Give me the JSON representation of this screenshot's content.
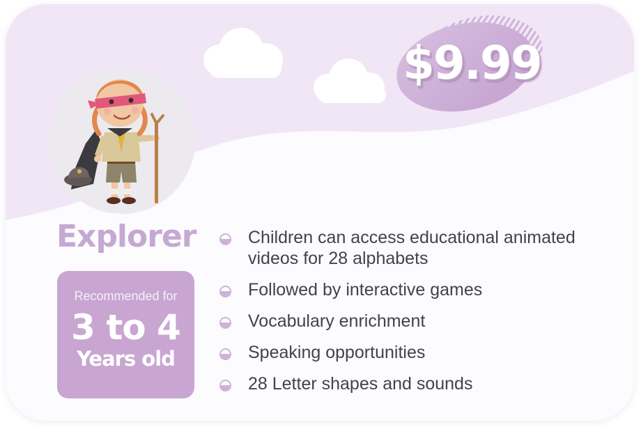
{
  "price": "$9.99",
  "plan": {
    "name": "Explorer",
    "recommended_label": "Recommended for",
    "age_range": "3 to 4",
    "age_unit": "Years old"
  },
  "features": [
    "Children can access educational animated videos for 28 alphabets",
    "Followed by interactive games",
    "Vocabulary enrichment",
    "Speaking opportunities",
    "28 Letter shapes and sounds"
  ],
  "colors": {
    "accent": "#c8a6d1",
    "title": "#c5a9d2",
    "background_wave": "#f1e6f5",
    "text": "#45414a"
  },
  "icons": {
    "mascot": "explorer-scout-child-illustration",
    "bullet": "half-filled-circle-bullet"
  }
}
